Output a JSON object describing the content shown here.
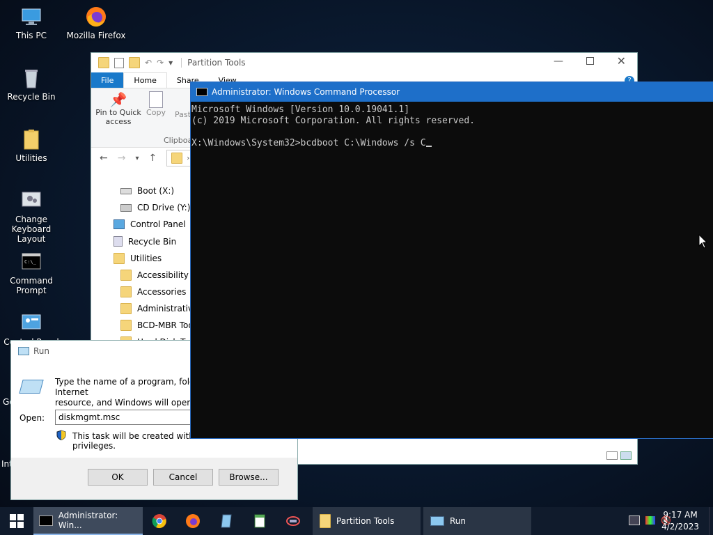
{
  "desktop": {
    "icons": [
      {
        "label": "This PC"
      },
      {
        "label": "Mozilla Firefox"
      },
      {
        "label": "Recycle Bin"
      },
      {
        "label": "Utilities"
      },
      {
        "label": "Change Keyboard Layout"
      },
      {
        "label": "Command Prompt"
      },
      {
        "label": "Control Panel"
      },
      {
        "label": "Go"
      },
      {
        "label": "Int"
      }
    ]
  },
  "explorer": {
    "title": "Partition Tools",
    "tabs": {
      "file": "File",
      "home": "Home",
      "share": "Share",
      "view": "View"
    },
    "ribbon": {
      "pin": "Pin to Quick access",
      "copy": "Copy",
      "paste": "Paste",
      "group": "Clipboard"
    },
    "tree": [
      {
        "label": "Boot (X:)"
      },
      {
        "label": "CD Drive (Y:) H"
      },
      {
        "label": "Control Panel"
      },
      {
        "label": "Recycle Bin"
      },
      {
        "label": "Utilities"
      },
      {
        "label": "Accessibility"
      },
      {
        "label": "Accessories"
      },
      {
        "label": "Administrative"
      },
      {
        "label": "BCD-MBR Tool"
      },
      {
        "label": "Hard Disk Tools"
      }
    ]
  },
  "cmd": {
    "title": "Administrator: Windows Command Processor",
    "lines": [
      "Microsoft Windows [Version 10.0.19041.1]",
      "(c) 2019 Microsoft Corporation. All rights reserved.",
      ""
    ],
    "prompt": "X:\\Windows\\System32>bcdboot C:\\Windows /s C"
  },
  "run": {
    "title": "Run",
    "desc1": "Type the name of a program, folder, document, or Internet",
    "desc2": "resource, and Windows will open it for you.",
    "open_label": "Open:",
    "value": "diskmgmt.msc",
    "admin_note": "This task will be created with administrative privileges.",
    "ok": "OK",
    "cancel": "Cancel",
    "browse": "Browse..."
  },
  "taskbar": {
    "items": [
      {
        "label": "Administrator: Win..."
      },
      {
        "label": "Partition Tools"
      },
      {
        "label": "Run"
      }
    ],
    "time": "9:17 AM",
    "date": "4/2/2023"
  }
}
